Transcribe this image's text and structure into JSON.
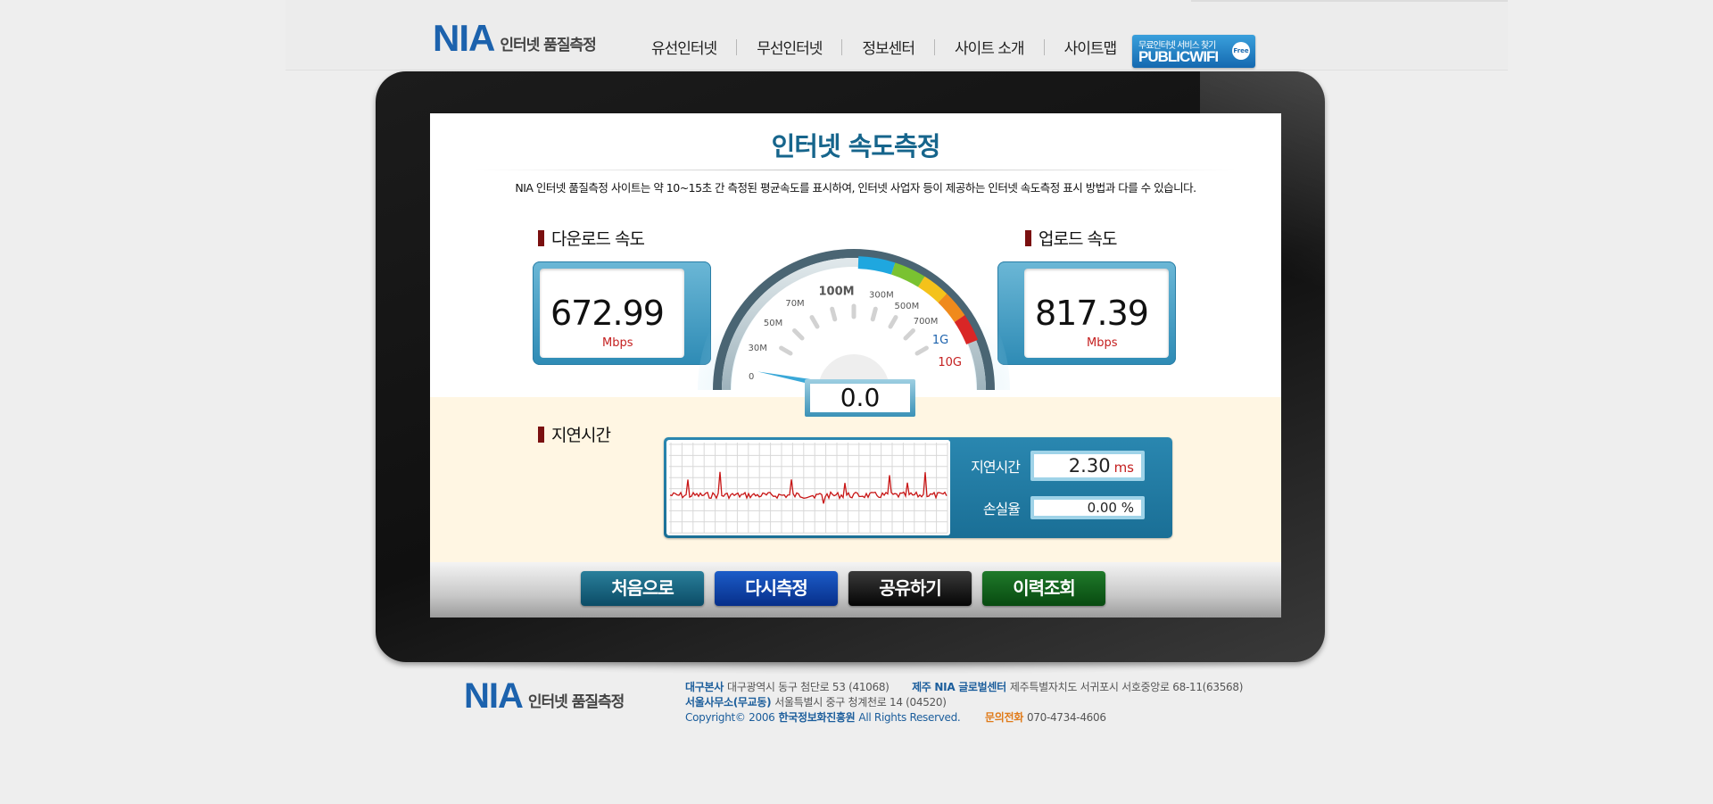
{
  "header": {
    "logo_main": "NIA",
    "logo_sub": "인터넷 품질측정",
    "nav": [
      "유선인터넷",
      "무선인터넷",
      "정보센터",
      "사이트 소개",
      "사이트맵"
    ],
    "publicwifi": {
      "top": "무료인터넷 서비스 찾기",
      "main": "PUBLICWIFI",
      "badge": "Free"
    }
  },
  "main": {
    "title": "인터넷 속도측정",
    "description": "NIA 인터넷 품질측정 사이트는 약 10~15초 간 측정된 평균속도를 표시하여, 인터넷 사업자 등이 제공하는 인터넷 속도측정 표시 방법과 다를 수 있습니다.",
    "download": {
      "label": "다운로드 속도",
      "value": "672.99",
      "unit": "Mbps"
    },
    "upload": {
      "label": "업로드 속도",
      "value": "817.39",
      "unit": "Mbps"
    },
    "gauge": {
      "ticks": [
        "0",
        "30M",
        "50M",
        "70M",
        "100M",
        "300M",
        "500M",
        "700M",
        "1G",
        "10G"
      ],
      "reading": "0.0",
      "needle_fraction": 0.06,
      "colors": {
        "cyan": "#1fa7df",
        "green": "#7ac231",
        "yellow": "#f4c21a",
        "orange": "#f08a1c",
        "red": "#d92626"
      }
    },
    "latency": {
      "label": "지연시간",
      "latency_label": "지연시간",
      "latency_value": "2.30",
      "latency_unit": "ms",
      "loss_label": "손실율",
      "loss_value": "0.00 %"
    },
    "buttons": {
      "home": "처음으로",
      "retest": "다시측정",
      "share": "공유하기",
      "history": "이력조회"
    }
  },
  "footer": {
    "logo_main": "NIA",
    "logo_sub": "인터넷 품질측정",
    "hq_label": "대구본사",
    "hq_addr": "대구광역시 동구 첨단로 53 (41068)",
    "jeju_label": "제주 NIA 글로벌센터",
    "jeju_addr": "제주특별자치도 서귀포시 서호중앙로 68-11(63568)",
    "seoul_label": "서울사무소(무교동)",
    "seoul_addr": "서울특별시 중구 청계천로 14 (04520)",
    "copyright_prefix": "Copyright© 2006",
    "copyright_org": "한국정보화진흥원",
    "copyright_suffix": "All Rights Reserved.",
    "phone_label": "문의전화",
    "phone": "070-4734-4606"
  }
}
